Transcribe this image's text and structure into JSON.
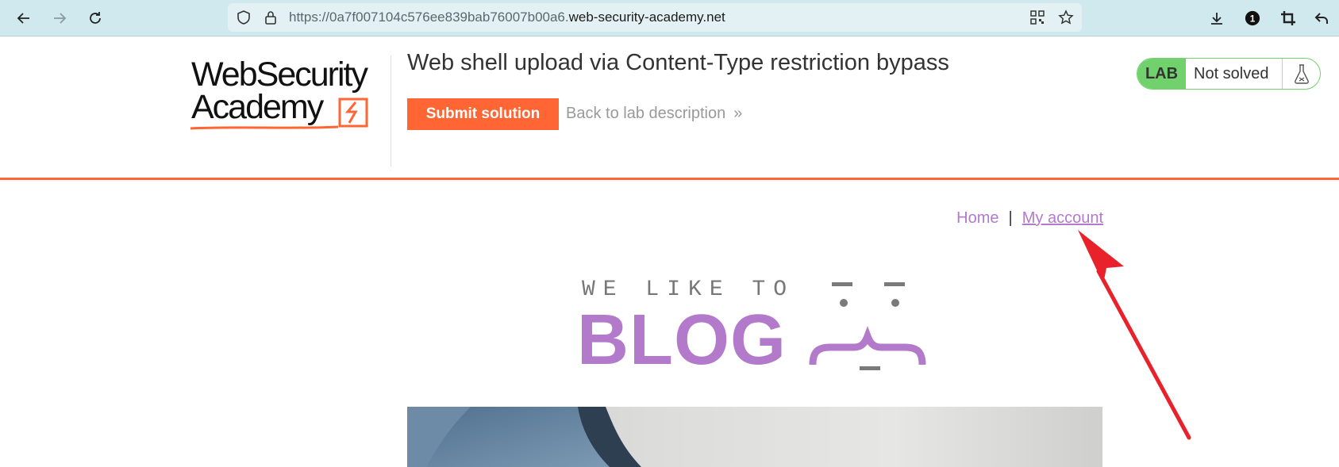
{
  "browser": {
    "url_prefix": "https://0a7f007104c576ee839bab76007b00a6.",
    "url_host": "web-security-academy.net",
    "notification_count": "1"
  },
  "lab": {
    "logo_line1": "WebSecurity",
    "logo_line2": "Academy",
    "title": "Web shell upload via Content-Type restriction bypass",
    "submit_label": "Submit solution",
    "back_label": "Back to lab description",
    "back_chevron": "»",
    "badge_label": "LAB",
    "badge_status": "Not solved"
  },
  "nav": {
    "home": "Home",
    "separator": "|",
    "my_account": "My account"
  },
  "blog": {
    "tagline": "WE LIKE TO",
    "title": "BLOG"
  },
  "colors": {
    "accent_orange": "#ff6633",
    "blog_purple": "#b37acb",
    "lab_green": "#70d16d",
    "arrow_red": "#e8212a"
  }
}
